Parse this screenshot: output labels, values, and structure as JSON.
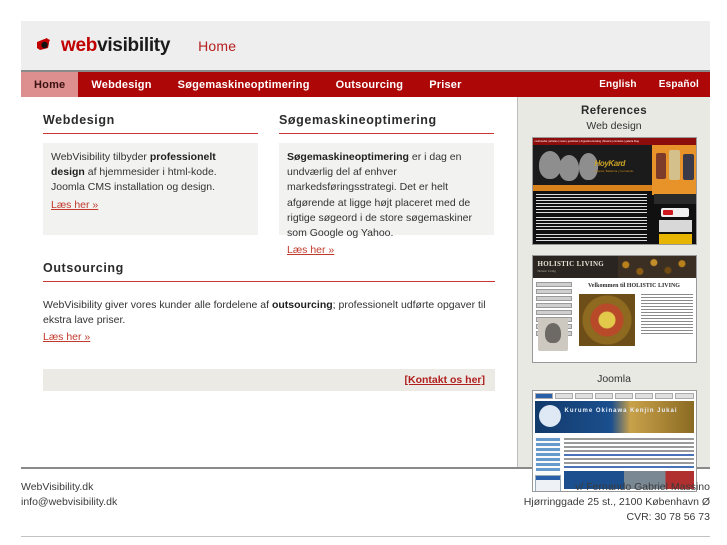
{
  "site": {
    "logo_web": "web",
    "logo_visibility": "visibility",
    "logo_icon": "camera-eye-icon",
    "page_title": "Home"
  },
  "nav": {
    "items": [
      {
        "label": "Home",
        "active": true
      },
      {
        "label": "Webdesign",
        "active": false
      },
      {
        "label": "Søgemaskineoptimering",
        "active": false
      },
      {
        "label": "Outsourcing",
        "active": false
      },
      {
        "label": "Priser",
        "active": false
      }
    ],
    "languages": [
      {
        "label": "English"
      },
      {
        "label": "Español"
      }
    ]
  },
  "main": {
    "webdesign": {
      "title": "Webdesign",
      "body_lead": "WebVisibility tilbyder ",
      "body_bold": "professionelt design",
      "body_rest": " af hjemmesider i html-kode. Joomla CMS installation og design.",
      "readmore": "Læs her »"
    },
    "seo": {
      "title": "Søgemaskineoptimering",
      "body_bold": "Søgemaskineoptimering",
      "body_rest": " er i dag en undværlig del af enhver markedsføringsstrategi. Det er helt afgørende at ligge højt placeret med de rigtige søgeord i de store søgemaskiner som Google og Yahoo.",
      "readmore": "Læs her »"
    },
    "outsourcing": {
      "title": "Outsourcing",
      "body_lead": "WebVisibility giver vores kunder alle fordelene af ",
      "body_bold": "outsourcing",
      "body_rest": "; professionelt udførte opgaver til ekstra lave priser.",
      "readmore": "Læs her »"
    },
    "contact_link": "[Kontakt os her]"
  },
  "sidebar": {
    "title": "References",
    "subtitle_webdesign": "Web design",
    "subtitle_joomla": "Joomla",
    "thumbs": [
      {
        "name": "reference-thumb-hoykard",
        "caption_title": "HoyKard",
        "caption_sub": "Música, Bailarina y Fernando"
      },
      {
        "name": "reference-thumb-holistic-living",
        "caption_title": "HOLISTIC LIVING",
        "caption_sub": "Velkommen til HOLISTIC LIVING",
        "menu_label": "Holistic Living"
      },
      {
        "name": "reference-thumb-joomla-site",
        "caption_title": "Kurume Okinawa Kenjin Jukai"
      }
    ]
  },
  "thumb1_links": "multimedia | artistas | news | gestionar | Argentina Hosting | Musica | contacto | galeria blog",
  "footer": {
    "left_line1": "WebVisibility.dk",
    "left_line2": "info@webvisibility.dk",
    "right_line1": "v/ Fernando Gabriel Massino",
    "right_line2": "Hjørringgade 25 st., 2100 København Ø",
    "right_line3": "CVR: 30 78 56 73"
  },
  "colors": {
    "brand_red": "#ad0707",
    "accent_red": "#c0392b",
    "nav_active_bg": "#dd8e8e",
    "header_bg": "#eeeeee",
    "sidebar_bg": "#e9e9e4",
    "section_box_bg": "#f2f2f0"
  }
}
